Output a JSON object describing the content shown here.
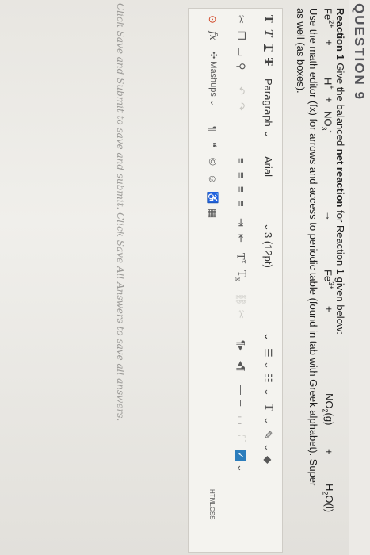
{
  "question": {
    "title": "QUESTION 9",
    "line1_bold": "Reaction 1",
    "line1_a": "Give the balanced",
    "line1_b": "net reaction",
    "line1_c": "for Reaction 1 given below:",
    "equation": {
      "fe2": "Fe",
      "fe2_sup": "2+",
      "plus1": "+",
      "h": "H",
      "h_sup": "+",
      "plus2": "+",
      "no3": "NO",
      "no3_sub": "3",
      "no3_sup": "-",
      "arrow": "→",
      "fe3": "Fe",
      "fe3_sup": "3+",
      "plus3": "+",
      "no2": "NO",
      "no2_sub": "2",
      "no2_tail": "(g)",
      "plus4": "+",
      "h2o": "H",
      "h2o_sub": "2",
      "h2o_tail": "O(l)"
    },
    "instr1": "Use the math editor (fx) for arrows and access to periodic table (found in tab with Greek alphabet). Super",
    "instr2": "as well (as boxes)."
  },
  "toolbar": {
    "row1": {
      "t_bold": "T",
      "t_italic": "T",
      "t_underline": "T",
      "t_strike": "T",
      "paragraph": "Paragraph",
      "font": "Arial",
      "size": "3 (12pt)"
    },
    "row2": {},
    "row3": {
      "fx": "fx",
      "mashups": "Mashups",
      "html": "HTML",
      "css": "CSS"
    }
  },
  "footer_note": "Click Save and Submit to save and submit. Click Save All Answers to save all answers."
}
